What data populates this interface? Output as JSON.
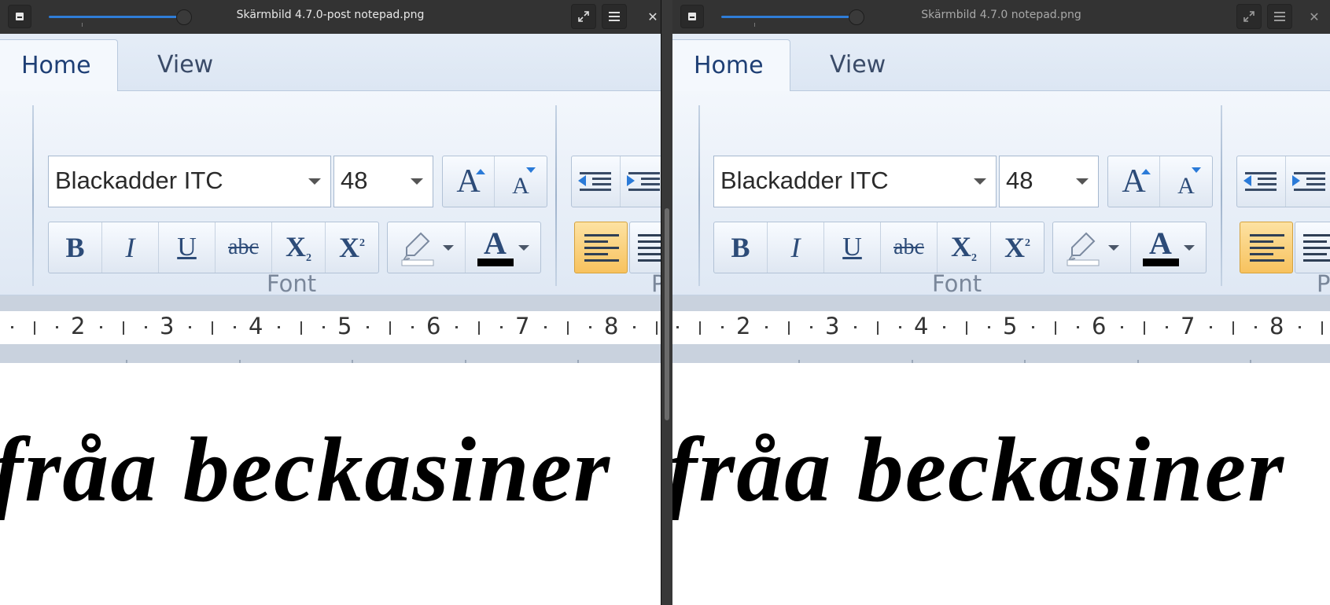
{
  "left_window": {
    "title": "Skärmbild 4.7.0-post notepad.png",
    "zoom_fraction": 0.9,
    "menu_icon": "hamburger-icon",
    "close_icon": "close-icon",
    "fullscreen_icon": "expand-icon"
  },
  "right_window": {
    "title": "Skärmbild 4.7.0 notepad.png",
    "zoom_fraction": 0.9,
    "menu_icon": "hamburger-icon",
    "close_icon": "close-icon",
    "fullscreen_icon": "expand-icon"
  },
  "ribbon": {
    "tab_home": "Home",
    "tab_view": "View",
    "font_name": "Blackadder ITC",
    "font_size": "48",
    "font_group_label": "Font",
    "paragraph_group_label_peek": "P",
    "bold": "B",
    "italic": "I",
    "underline": "U",
    "strikethrough": "abc",
    "subscript": "X",
    "subscript_small": "2",
    "superscript": "X",
    "superscript_small": "2",
    "grow_font": "A",
    "shrink_font": "A",
    "font_color_glyph": "A",
    "colors": {
      "font_color": "#000000",
      "accent_blue": "#2a7ad8",
      "align_active": "#f7c25e"
    }
  },
  "ruler": {
    "numbers": [
      "2",
      "3",
      "4",
      "5",
      "6",
      "7",
      "8"
    ]
  },
  "document": {
    "text": "fråa beckasiner"
  }
}
